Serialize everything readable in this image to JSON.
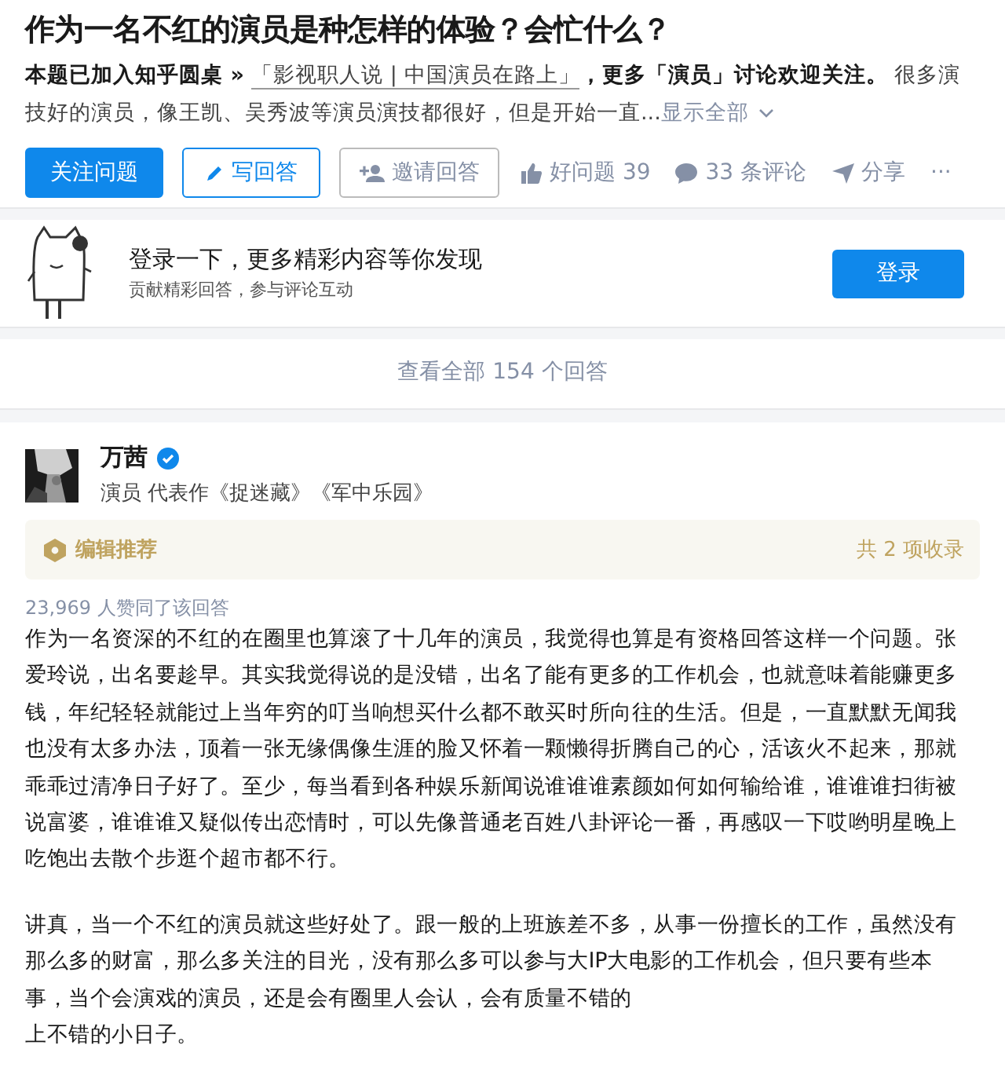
{
  "question": {
    "title": "作为一名不红的演员是种怎样的体验？会忙什么？",
    "roundtable_prefix": "本题已加入知乎圆桌 »",
    "roundtable_link": "「影视职人说 | 中国演员在路上」",
    "topic_note": "，更多「演员」讨论欢迎关注。",
    "excerpt": "很多演技好的演员，像王凯、吴秀波等演员演技都很好，但是开始一直...",
    "show_all": "显示全部"
  },
  "actions": [
    {
      "kind": "primary",
      "label": "关注问题"
    },
    {
      "kind": "outline",
      "label": "写回答"
    },
    {
      "kind": "outline-gray",
      "label": "邀请回答"
    },
    {
      "kind": "text",
      "label": "好问题 39"
    },
    {
      "kind": "text",
      "label": "33 条评论"
    },
    {
      "kind": "text",
      "label": "分享"
    },
    {
      "kind": "more",
      "label": "···"
    }
  ],
  "login_card": {
    "title": "登录一下，更多精彩内容等你发现",
    "subtitle": "贡献精彩回答，参与评论互动",
    "button": "登录"
  },
  "view_all": "查看全部 154 个回答",
  "answer": {
    "author": "万茜",
    "verified": true,
    "bio": "演员 代表作《捉迷藏》《军中乐园》",
    "recommend": "编辑推荐",
    "collections": "共 2 项收录",
    "votes": "23,969 人赞同了该回答",
    "paragraphs": [
      [
        "作为一名资深的不红的在圈里也算滚了十几年的演员，我觉得也算是有资格回答这样一个问题。张",
        "爱玲说，出名要趁早。其实我觉得说的是没错，出名了能有更多的工作机会，也就意味着能赚更多",
        "钱，年纪轻轻就能过上当年穷的叮当响想买什么都不敢买时所向往的生活。但是，一直默默无闻我",
        "也没有太多办法，顶着一张无缘偶像生涯的脸又怀着一颗懒得折腾自己的心，活该火不起来，那就",
        "乖乖过清净日子好了。至少，每当看到各种娱乐新闻说谁谁谁素颜如何如何输给谁，谁谁谁扫街被",
        "说富婆，谁谁谁又疑似传出恋情时，可以先像普通老百姓八卦评论一番，再感叹一下哎哟明星晚上",
        "吃饱出去散个步逛个超市都不行。"
      ],
      [
        "讲真，当一个不红的演员就这些好处了。跟一般的上班族差不多，从事一份擅长的工作，虽然没有",
        "那么多的财富，那么多关注的目光，没有那么多可以参与大IP大电影的工作机会，但只要有些本",
        "事，当个会演戏的演员，还是会有圈里人会认，会有质量不错的",
        "上不错的小日子。"
      ]
    ]
  }
}
